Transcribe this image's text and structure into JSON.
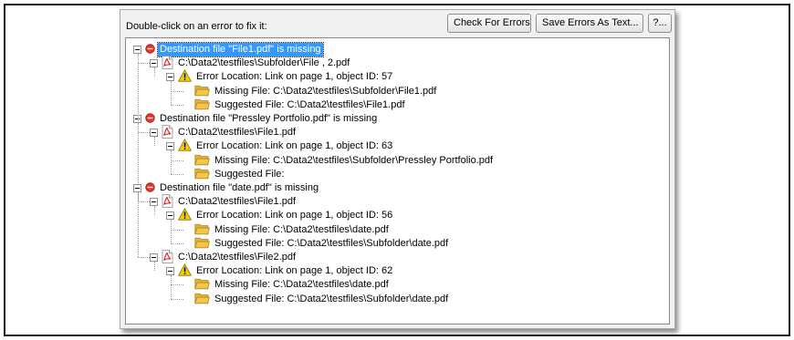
{
  "instruction": "Double-click on an error to fix it:",
  "buttons": {
    "check": "Check For Errors",
    "save": "Save Errors As Text...",
    "help": "?..."
  },
  "tree": {
    "errors": [
      {
        "label": "Destination file \"File1.pdf\" is missing",
        "selected": true,
        "files": [
          {
            "path": "C:\\Data2\\testfiles\\Subfolder\\File , 2.pdf",
            "location": "Error Location: Link on page 1, object ID: 57",
            "missing": "Missing File: C:\\Data2\\testfiles\\Subfolder\\File1.pdf",
            "suggested": "Suggested File: C:\\Data2\\testfiles\\File1.pdf"
          }
        ]
      },
      {
        "label": "Destination file \"Pressley Portfolio.pdf\" is missing",
        "selected": false,
        "files": [
          {
            "path": "C:\\Data2\\testfiles\\File1.pdf",
            "location": "Error Location: Link on page 1, object ID: 63",
            "missing": "Missing File: C:\\Data2\\testfiles\\Subfolder\\Pressley Portfolio.pdf",
            "suggested": "Suggested File:"
          }
        ]
      },
      {
        "label": "Destination file \"date.pdf\" is missing",
        "selected": false,
        "files": [
          {
            "path": "C:\\Data2\\testfiles\\File1.pdf",
            "location": "Error Location: Link on page 1, object ID: 56",
            "missing": "Missing File: C:\\Data2\\testfiles\\date.pdf",
            "suggested": "Suggested File: C:\\Data2\\testfiles\\Subfolder\\date.pdf"
          },
          {
            "path": "C:\\Data2\\testfiles\\File2.pdf",
            "location": "Error Location: Link on page 1, object ID: 62",
            "missing": "Missing File: C:\\Data2\\testfiles\\date.pdf",
            "suggested": "Suggested File: C:\\Data2\\testfiles\\Subfolder\\date.pdf"
          }
        ]
      }
    ]
  },
  "icons": {
    "error": "error-circle-icon",
    "pdf": "pdf-file-icon",
    "warning": "warning-triangle-icon",
    "folder": "folder-icon"
  },
  "colors": {
    "selection": "#3399ff",
    "error": "#e0392b",
    "warning": "#f5d000",
    "folder": "#f3c64a",
    "pdf": "#cc1f1f"
  }
}
